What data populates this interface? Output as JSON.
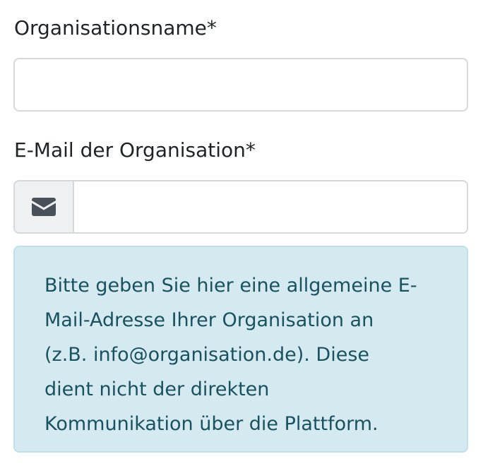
{
  "form": {
    "organisation_name": {
      "label": "Organisationsname*",
      "value": "",
      "placeholder": ""
    },
    "organisation_email": {
      "label": "E-Mail der Organisation*",
      "value": "",
      "placeholder": "",
      "addon_icon": "envelope-icon"
    },
    "email_hint": "Bitte geben Sie hier eine allgemeine E-\nMail-Adresse Ihrer Organisation an\n(z.B. info@organisation.de). Diese\ndient nicht der direkten\nKommunikation über die Plattform."
  },
  "colors": {
    "hint_background": "#d5eaf0",
    "hint_text": "#19525f",
    "addon_background": "#eef0f2",
    "border": "#d6d8db"
  }
}
